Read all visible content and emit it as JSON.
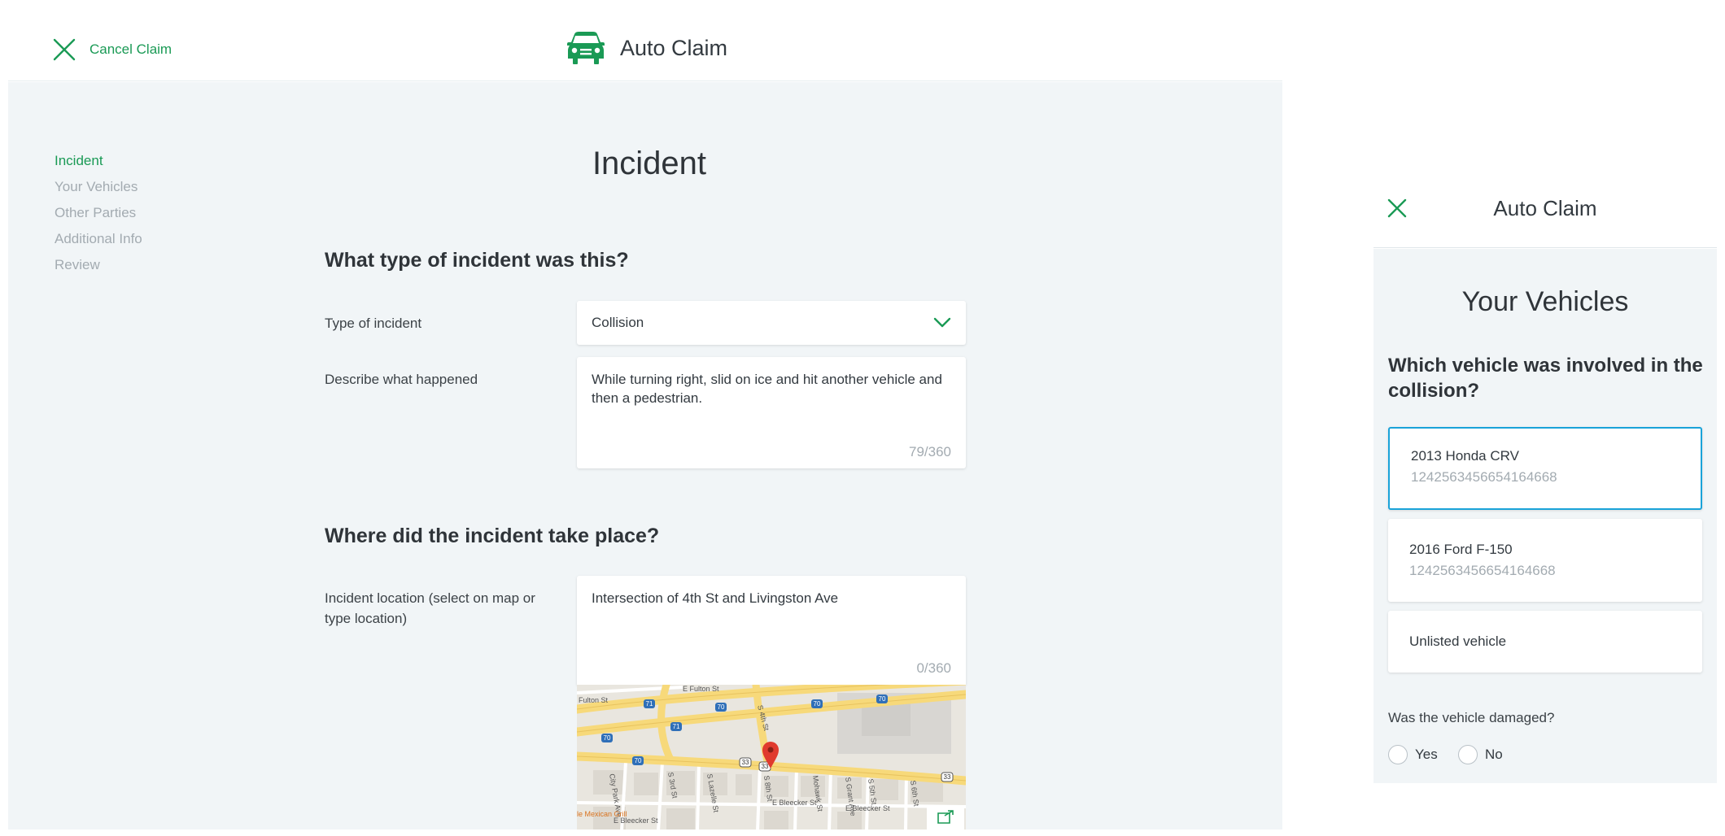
{
  "header": {
    "cancel_label": "Cancel Claim",
    "app_title": "Auto Claim"
  },
  "steps": [
    {
      "label": "Incident",
      "active": true
    },
    {
      "label": "Your Vehicles",
      "active": false
    },
    {
      "label": "Other Parties",
      "active": false
    },
    {
      "label": "Additional Info",
      "active": false
    },
    {
      "label": "Review",
      "active": false
    }
  ],
  "page_title": "Incident",
  "section_type": {
    "heading": "What type of incident was this?",
    "type_label": "Type of incident",
    "type_value": "Collision",
    "describe_label": "Describe what happened",
    "describe_value": "While turning right, slid on ice and hit another vehicle and then a pedestrian.",
    "describe_count": "79/360"
  },
  "section_location": {
    "heading": "Where did the incident take place?",
    "location_label": "Incident location (select on map or type location)",
    "location_value": "Intersection of 4th St and Livingston Ave",
    "location_count": "0/360"
  },
  "map": {
    "labels": {
      "fulton": "Fulton St",
      "fourth": "S 4th St",
      "mexican": "le Mexican Grill",
      "bleecker": "E Bleecker St",
      "city_park": "City Park Ave",
      "s3rd": "S 3rd St",
      "s5th": "S 5th St",
      "s6th": "S 6th St",
      "mohawk": "Mohawk St",
      "lazelle": "S Lazelle St",
      "e_fulton": "E Fulton St",
      "s_8th": "S 8th St",
      "grant": "S Grant Ave"
    },
    "shields": [
      "70",
      "70",
      "70",
      "70",
      "71",
      "71",
      "33",
      "33",
      "33",
      "70"
    ]
  },
  "mobile": {
    "title": "Auto Claim",
    "page_title": "Your Vehicles",
    "question": "Which vehicle was involved in the collision?",
    "vehicles": [
      {
        "name": "2013 Honda CRV",
        "vin": "1242563456654164668",
        "selected": true
      },
      {
        "name": "2016 Ford F-150",
        "vin": "1242563456654164668",
        "selected": false
      },
      {
        "name": "Unlisted vehicle",
        "vin": "",
        "selected": false
      }
    ],
    "damaged_label": "Was the vehicle damaged?",
    "yes_label": "Yes",
    "no_label": "No"
  },
  "colors": {
    "accent_green": "#1a9a55",
    "selected_blue": "#1aa3d9",
    "background": "#f1f5f7",
    "map_pin": "#e03a2e"
  }
}
